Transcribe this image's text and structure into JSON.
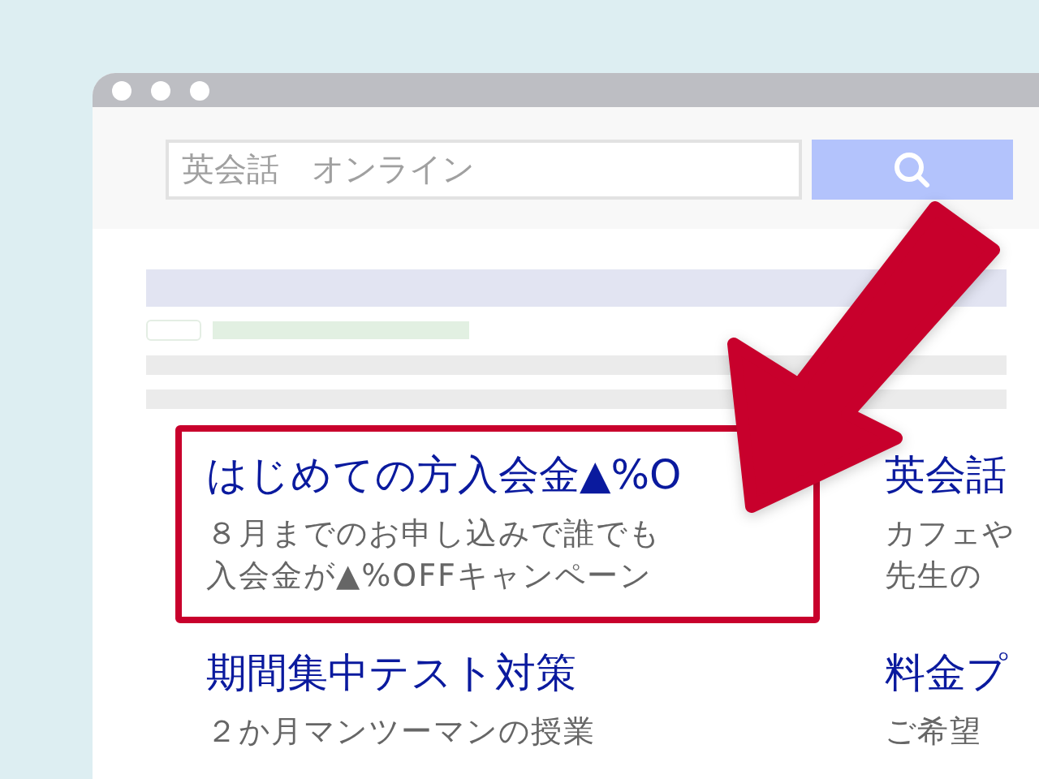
{
  "search": {
    "value": "英会話　オンライン"
  },
  "results": [
    {
      "title": "はじめての方入会金▲%O",
      "description": [
        "８月までのお申し込みで誰でも",
        "入会金が▲%OFFキャンペーン"
      ],
      "highlighted": true
    },
    {
      "title": "英会話",
      "description": [
        "カフェや",
        "先生の"
      ],
      "highlighted": false
    },
    {
      "title": "期間集中テスト対策",
      "description": [
        "２か月マンツーマンの授業"
      ],
      "highlighted": false
    },
    {
      "title": "料金プ",
      "description": [
        "ご希望"
      ],
      "highlighted": false
    }
  ]
}
